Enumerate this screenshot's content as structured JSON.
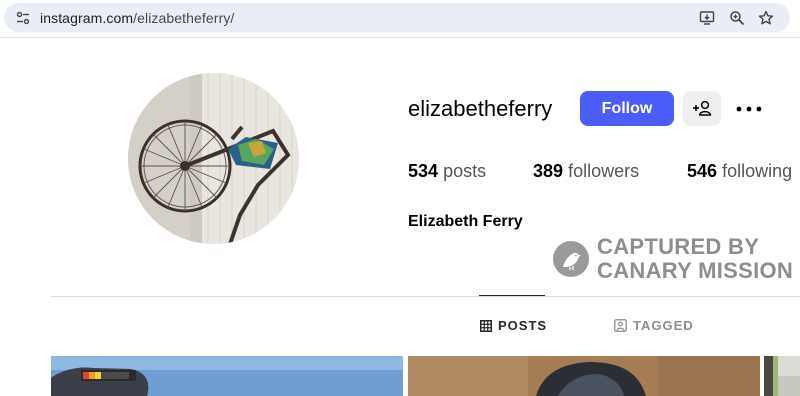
{
  "browser": {
    "url_domain": "instagram.com",
    "url_path": "/elizabetheferry/"
  },
  "profile": {
    "username": "elizabetheferry",
    "follow_label": "Follow",
    "full_name": "Elizabeth Ferry",
    "stats": {
      "posts_count": "534",
      "posts_label": "posts",
      "followers_count": "389",
      "followers_label": "followers",
      "following_count": "546",
      "following_label": "following"
    }
  },
  "watermark": {
    "line1": "CAPTURED BY",
    "line2": "CANARY MISSION"
  },
  "tabs": {
    "posts": "POSTS",
    "tagged": "TAGGED"
  },
  "colors": {
    "accent": "#4a5df9",
    "urlbar": "#e9eef6"
  }
}
